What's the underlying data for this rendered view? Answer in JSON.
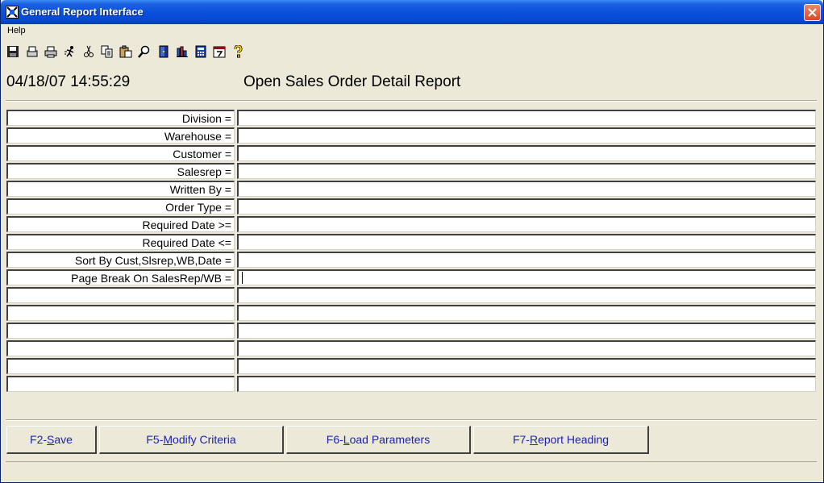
{
  "window": {
    "title": "General Report Interface"
  },
  "menu": {
    "help": "Help"
  },
  "toolbar": {
    "icons": [
      "save-icon",
      "print-preview-icon",
      "printer-icon",
      "run-icon",
      "cut-icon",
      "copy-icon",
      "paste-icon",
      "find-icon",
      "exit-door-icon",
      "chart-icon",
      "calculator-icon",
      "calendar-icon",
      "help-icon"
    ]
  },
  "header": {
    "datetime": "04/18/07 14:55:29",
    "report_title": "Open Sales Order Detail Report"
  },
  "criteria": [
    {
      "label": "Division =",
      "value": ""
    },
    {
      "label": "Warehouse =",
      "value": ""
    },
    {
      "label": "Customer =",
      "value": ""
    },
    {
      "label": "Salesrep =",
      "value": ""
    },
    {
      "label": "Written By =",
      "value": ""
    },
    {
      "label": "Order Type =",
      "value": ""
    },
    {
      "label": "Required Date >=",
      "value": ""
    },
    {
      "label": "Required Date <=",
      "value": ""
    },
    {
      "label": "Sort By Cust,Slsrep,WB,Date =",
      "value": ""
    },
    {
      "label": "Page Break On SalesRep/WB =",
      "value": ""
    },
    {
      "label": "",
      "value": ""
    },
    {
      "label": "",
      "value": ""
    },
    {
      "label": "",
      "value": ""
    },
    {
      "label": "",
      "value": ""
    },
    {
      "label": "",
      "value": ""
    },
    {
      "label": "",
      "value": ""
    }
  ],
  "buttons": [
    {
      "prefix": "F2-",
      "accel": "S",
      "rest": "ave"
    },
    {
      "prefix": "F5-",
      "accel": "M",
      "rest": "odify Criteria"
    },
    {
      "prefix": "F6-",
      "accel": "L",
      "rest": "oad Parameters"
    },
    {
      "prefix": "F7-",
      "accel": "R",
      "rest": "eport Heading"
    }
  ],
  "colors": {
    "titlebar": "#0a51dd",
    "button_text": "#1a22b8",
    "face": "#ece9d8"
  }
}
